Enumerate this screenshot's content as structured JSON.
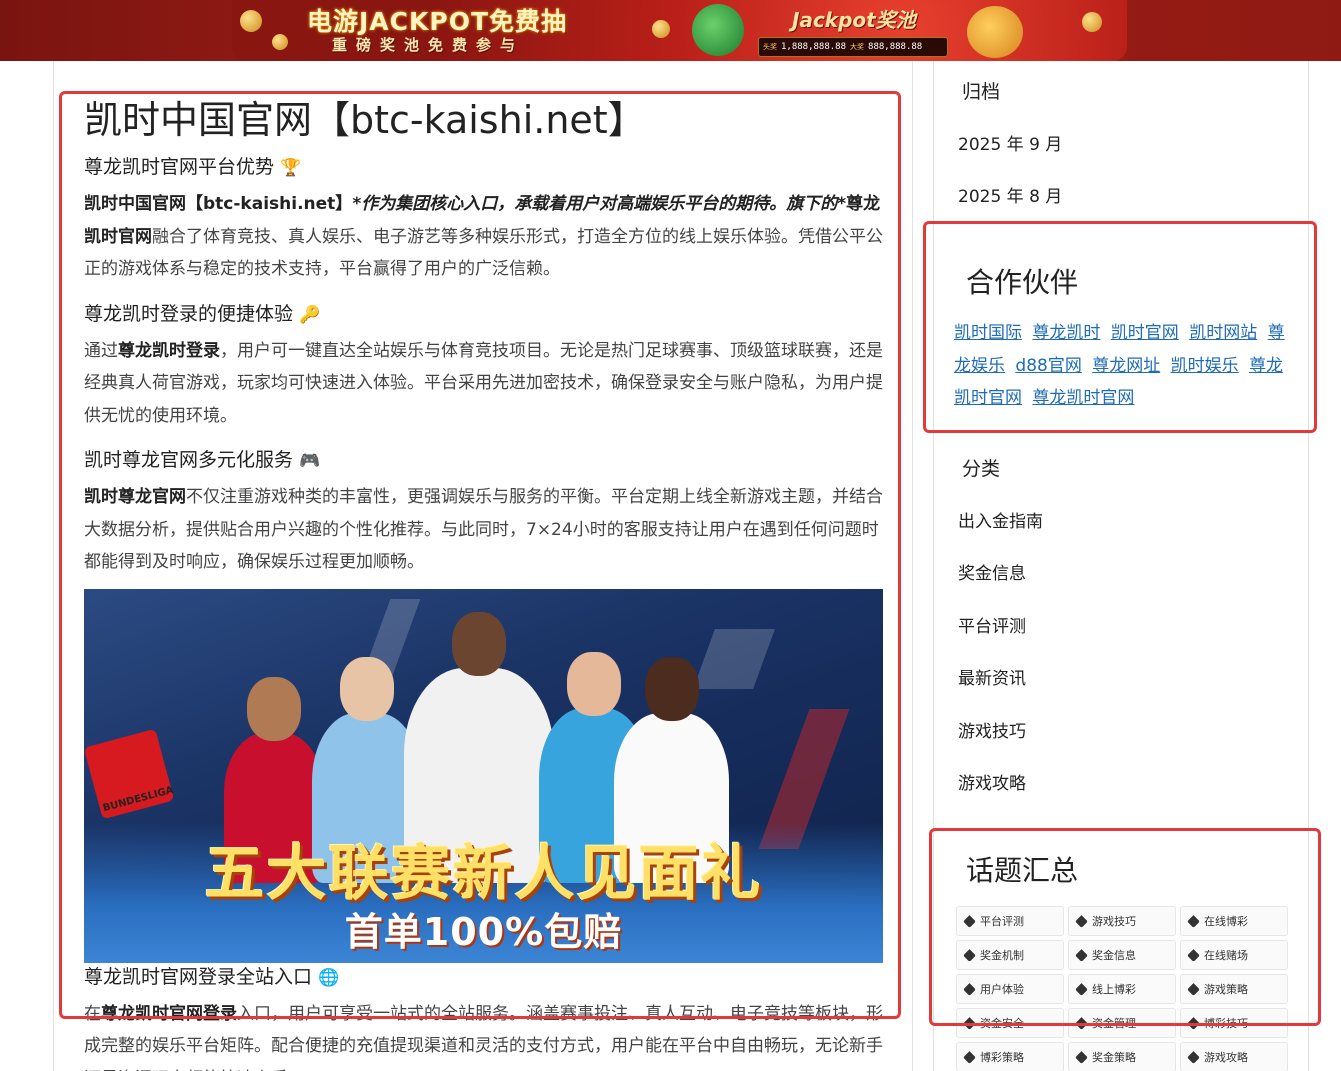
{
  "banner": {
    "title": "电游JACKPOT免费抽",
    "subtitle": "重磅奖池免费参与",
    "right_title": "Jackpot奖池",
    "prize_1_tag": "头奖",
    "prize_1_value": "1,888,888.88",
    "prize_2_tag": "大奖",
    "prize_2_value": "888,888.88"
  },
  "article": {
    "title": "凯时中国官网【btc-kaishi.net】",
    "sections": [
      {
        "heading": "尊龙凯时官网平台优势",
        "emoji": "🏆",
        "p_lead_bold": "凯时中国官网【btc-kaishi.net】",
        "p_italic": "*作为集团核心入口，承载着用户对高端娱乐平台的期待。旗下的*",
        "p_bold2": "尊龙凯时官网",
        "p_rest": "融合了体育竞技、真人娱乐、电子游艺等多种娱乐形式，打造全方位的线上娱乐体验。凭借公平公正的游戏体系与稳定的技术支持，平台赢得了用户的广泛信赖。"
      },
      {
        "heading": "尊龙凯时登录的便捷体验",
        "emoji": "🔑",
        "p_pre": "通过",
        "p_bold": "尊龙凯时登录",
        "p_rest": "，用户可一键直达全站娱乐与体育竞技项目。无论是热门足球赛事、顶级篮球联赛，还是经典真人荷官游戏，玩家均可快速进入体验。平台采用先进加密技术，确保登录安全与账户隐私，为用户提供无忧的使用环境。"
      },
      {
        "heading": "凯时尊龙官网多元化服务",
        "emoji": "🎮",
        "p_bold": "凯时尊龙官网",
        "p_rest": "不仅注重游戏种类的丰富性，更强调娱乐与服务的平衡。平台定期上线全新游戏主题，并结合大数据分析，提供贴合用户兴趣的个性化推荐。与此同时，7×24小时的客服支持让用户在遇到任何问题时都能得到及时响应，确保娱乐过程更加顺畅。"
      }
    ],
    "promo": {
      "title": "五大联赛新人见面礼",
      "subtitle": "首单100%包赔",
      "league_label": "BUNDESLIGA"
    },
    "section4": {
      "heading": "尊龙凯时官网登录全站入口",
      "emoji": "🌐",
      "p_pre": "在",
      "p_bold": "尊龙凯时官网登录",
      "p_rest": "入口，用户可享受一站式的全站服务。涵盖赛事投注、真人互动、电子竞技等板块，形成完整的娱乐平台矩阵。配合便捷的充值提现渠道和灵活的支付方式，用户能在平台中自由畅玩，无论新手还是资深玩家都能快速上手。"
    }
  },
  "sidebar": {
    "archive": {
      "heading": "归档",
      "items": [
        "2025 年 9 月",
        "2025 年 8 月"
      ]
    },
    "partners": {
      "heading": "合作伙伴",
      "links": [
        "凯时国际",
        "尊龙凯时",
        "凯时官网",
        "凯时网站",
        "尊龙娱乐",
        "d88官网",
        "尊龙网址",
        "凯时娱乐",
        "尊龙凯时官网",
        "尊龙凯时官网"
      ]
    },
    "categories": {
      "heading": "分类",
      "items": [
        "出入金指南",
        "奖金信息",
        "平台评测",
        "最新资讯",
        "游戏技巧",
        "游戏攻略"
      ]
    },
    "topics": {
      "heading": "话题汇总",
      "tags": [
        "平台评测",
        "游戏技巧",
        "在线博彩",
        "奖金机制",
        "奖金信息",
        "在线赌场",
        "用户体验",
        "线上博彩",
        "游戏策略",
        "资金安全",
        "资金管理",
        "博彩技巧",
        "博彩策略",
        "奖金策略",
        "游戏攻略"
      ]
    }
  },
  "colors": {
    "link": "#1e6bb8",
    "highlight": "#e23a3a",
    "banner_red": "#a51f17"
  }
}
